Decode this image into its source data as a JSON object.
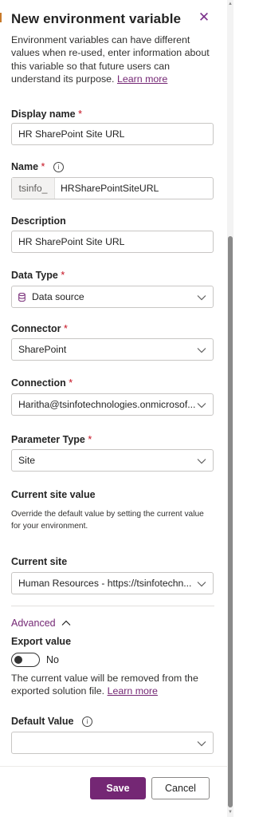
{
  "panel": {
    "title": "New environment variable",
    "intro": "Environment variables can have different values when re-used, enter information about this variable so that future users can understand its purpose.",
    "learn_more": "Learn more"
  },
  "display_name": {
    "label": "Display name",
    "required": "*",
    "value": "HR SharePoint Site URL"
  },
  "name": {
    "label": "Name",
    "required": "*",
    "prefix": "tsinfo_",
    "value": "HRSharePointSiteURL"
  },
  "description": {
    "label": "Description",
    "value": "HR SharePoint Site URL"
  },
  "data_type": {
    "label": "Data Type",
    "required": "*",
    "value": "Data source",
    "icon": "database-icon"
  },
  "connector": {
    "label": "Connector",
    "required": "*",
    "value": "SharePoint"
  },
  "connection": {
    "label": "Connection",
    "required": "*",
    "value": "Haritha@tsinfotechnologies.onmicrosof..."
  },
  "parameter_type": {
    "label": "Parameter Type",
    "required": "*",
    "value": "Site"
  },
  "current_site_value": {
    "heading": "Current site value",
    "help": "Override the default value by setting the current value for your environment."
  },
  "current_site": {
    "label": "Current site",
    "value": "Human Resources - https://tsinfotechn..."
  },
  "advanced": {
    "label": "Advanced",
    "export_label": "Export value",
    "toggle_state": "No",
    "note": "The current value will be removed from the exported solution file.",
    "learn_more": "Learn more"
  },
  "default_value": {
    "label": "Default Value",
    "value": ""
  },
  "footer": {
    "save": "Save",
    "cancel": "Cancel"
  },
  "colors": {
    "accent": "#742774",
    "required": "#c50f1f",
    "border": "#c8c6c4"
  }
}
